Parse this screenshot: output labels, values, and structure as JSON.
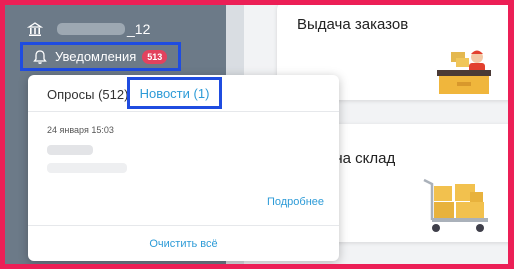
{
  "sidebar": {
    "user_suffix": "_12",
    "notifications_label": "Уведомления",
    "notifications_count": "513"
  },
  "dropdown": {
    "tab_polls": "Опросы (512)",
    "tab_news": "Новости (1)",
    "news_date": "24 января 15:03",
    "more_link": "Подробнее",
    "clear_all": "Очистить всё"
  },
  "cards": [
    {
      "title": "Выдача заказов",
      "icon": "cashier-icon"
    },
    {
      "title": "вка на склад",
      "icon": "cart-boxes-icon"
    }
  ],
  "colors": {
    "frame": "#ec1f56",
    "highlight": "#1f4ce0",
    "sidebar": "#6c7a88",
    "link": "#2d9bd7",
    "badge": "#e2425e"
  }
}
